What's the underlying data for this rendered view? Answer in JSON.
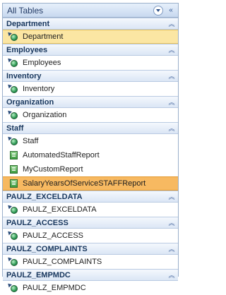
{
  "pane": {
    "title": "All Tables",
    "dropdown_icon": "dropdown-circle-icon",
    "collapse_icon": "double-chevron-left-icon"
  },
  "groups": [
    {
      "label": "Department",
      "items": [
        {
          "label": "Department",
          "icon": "linked-table-icon",
          "selected": "yellow"
        }
      ]
    },
    {
      "label": "Employees",
      "items": [
        {
          "label": "Employees",
          "icon": "linked-table-icon"
        }
      ]
    },
    {
      "label": "Inventory",
      "items": [
        {
          "label": "Inventory",
          "icon": "linked-table-icon"
        }
      ]
    },
    {
      "label": "Organization",
      "items": [
        {
          "label": "Organization",
          "icon": "linked-table-icon"
        }
      ]
    },
    {
      "label": "Staff",
      "items": [
        {
          "label": "Staff",
          "icon": "linked-table-icon"
        },
        {
          "label": "AutomatedStaffReport",
          "icon": "report-icon"
        },
        {
          "label": "MyCustomReport",
          "icon": "report-icon"
        },
        {
          "label": "SalaryYearsOfServiceSTAFFReport",
          "icon": "report-icon",
          "selected": "orange"
        }
      ]
    },
    {
      "label": "PAULZ_EXCELDATA",
      "items": [
        {
          "label": "PAULZ_EXCELDATA",
          "icon": "linked-table-icon"
        }
      ]
    },
    {
      "label": "PAULZ_ACCESS",
      "items": [
        {
          "label": "PAULZ_ACCESS",
          "icon": "linked-table-icon"
        }
      ]
    },
    {
      "label": "PAULZ_COMPLAINTS",
      "items": [
        {
          "label": "PAULZ_COMPLAINTS",
          "icon": "linked-table-icon"
        }
      ]
    },
    {
      "label": "PAULZ_EMPMDC",
      "items": [
        {
          "label": "PAULZ_EMPMDC",
          "icon": "linked-table-icon"
        }
      ]
    }
  ],
  "colors": {
    "header_text": "#17365d",
    "selected_yellow": "#fbe6a3",
    "selected_orange": "#f7b961"
  }
}
